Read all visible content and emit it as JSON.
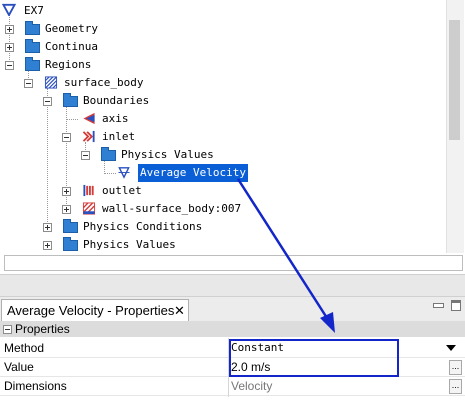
{
  "tree": {
    "items": [
      {
        "label": "EX7"
      },
      {
        "label": "Geometry"
      },
      {
        "label": "Continua"
      },
      {
        "label": "Regions"
      },
      {
        "label": "surface_body"
      },
      {
        "label": "Boundaries"
      },
      {
        "label": "axis"
      },
      {
        "label": "inlet"
      },
      {
        "label": "Physics Values"
      },
      {
        "label": "Average Velocity"
      },
      {
        "label": "outlet"
      },
      {
        "label": "wall-surface_body:007"
      },
      {
        "label": "Physics Conditions"
      },
      {
        "label": "Physics Values"
      }
    ]
  },
  "properties": {
    "tab_title": "Average Velocity - Properties",
    "close_glyph": "✕",
    "section": "Properties",
    "rows": [
      {
        "key": "Method",
        "value": "Constant"
      },
      {
        "key": "Value",
        "value": "2.0 m/s"
      },
      {
        "key": "Dimensions",
        "value": "Velocity"
      }
    ]
  },
  "colors": {
    "selection": "#0a5fd6",
    "annotation": "#1226c9",
    "folder": "#2f7fd3"
  }
}
